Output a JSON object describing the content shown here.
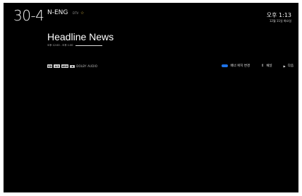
{
  "channel": {
    "number": "30-4",
    "name": "N-ENG",
    "badge": "DTV",
    "favorite_icon": "star-icon"
  },
  "clock": {
    "time": "오후 1:13",
    "date": "12월 11일 화요일"
  },
  "program": {
    "title": "Headline News",
    "time_range": "오후 12:00 - 오후 1:00",
    "progress": 1.0
  },
  "badges": {
    "items": [
      "SD",
      "4:3",
      "480i"
    ],
    "dolby_label": "DOLBY AUDIO"
  },
  "help": {
    "banner_label": "배너 위치 변경",
    "channel_label": "채널",
    "next_label": "다음"
  },
  "colors": {
    "screen_bg": "#000000",
    "blue_key": "#1e73e8",
    "favorite": "#d4b441"
  }
}
